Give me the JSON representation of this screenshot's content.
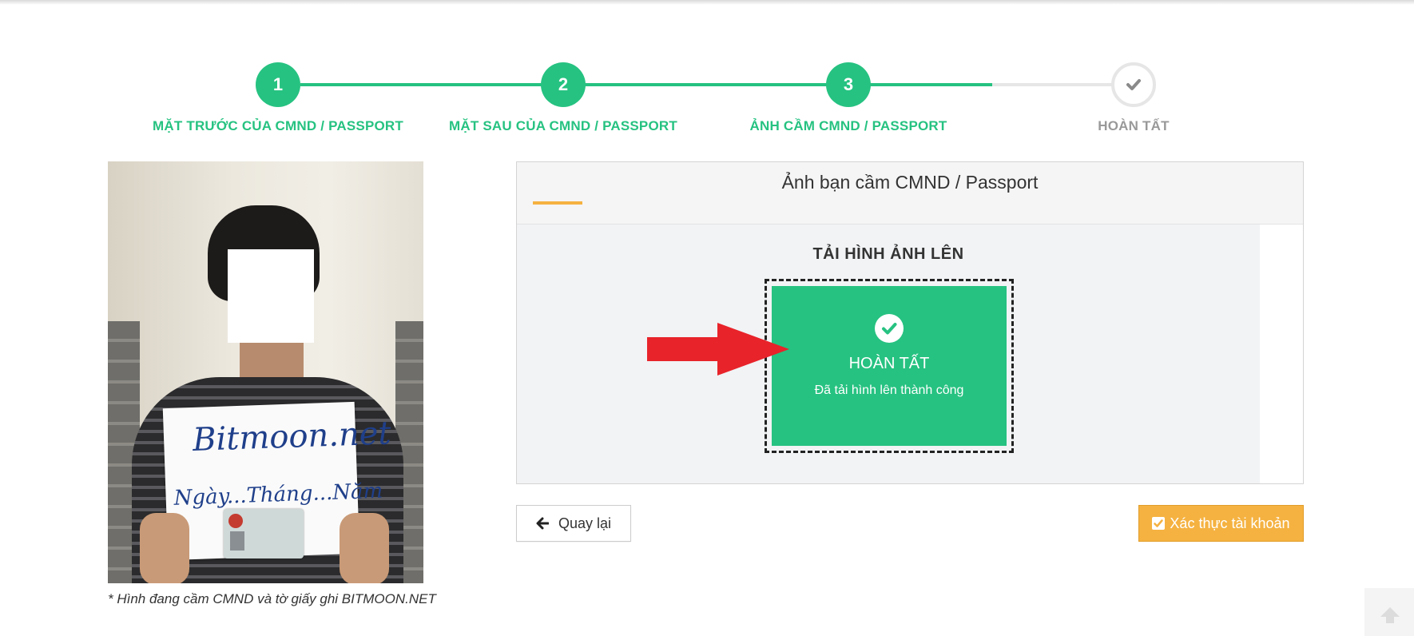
{
  "stepper": {
    "steps": [
      {
        "number": "1",
        "label": "MẶT TRƯỚC CỦA CMND / PASSPORT",
        "state": "done"
      },
      {
        "number": "2",
        "label": "MẶT SAU CỦA CMND / PASSPORT",
        "state": "done"
      },
      {
        "number": "3",
        "label": "ẢNH CẦM CMND / PASSPORT",
        "state": "done"
      },
      {
        "number": "",
        "icon": "check-icon",
        "label": "HOÀN TẤT",
        "state": "todo"
      }
    ]
  },
  "sample": {
    "paper_line1": "Bitmoon.net",
    "paper_line2": "Ngày...Tháng...Năm",
    "caption": "* Hình đang cầm CMND và tờ giấy ghi BITMOON.NET"
  },
  "panel": {
    "title": "Ảnh bạn cầm CMND / Passport",
    "upload_title": "TẢI HÌNH ẢNH LÊN",
    "done_title": "HOÀN TẤT",
    "done_subtitle": "Đã tải hình lên thành công"
  },
  "buttons": {
    "back_label": "Quay lại",
    "verify_label": "Xác thực tài khoản"
  },
  "colors": {
    "success": "#26c281",
    "accent": "#f5b241",
    "arrow": "#e8232a",
    "inactive": "#999999"
  }
}
